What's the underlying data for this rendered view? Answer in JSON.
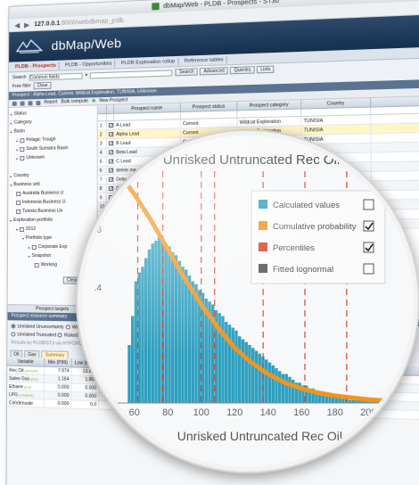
{
  "browser": {
    "tab_title": "dbMap/Web - PLDB - Prospects - ST30",
    "url_host": "127.0.0.1",
    "url_rest": ":8000/webdbmap_pldb"
  },
  "app": {
    "title": "dbMap/Web"
  },
  "menu": [
    {
      "label": "PLDB - Prospects",
      "active": true
    },
    {
      "label": "PLDB - Opportunities",
      "active": false
    },
    {
      "label": "PLDB Exploration rollup",
      "active": false
    },
    {
      "label": "Reference tables",
      "active": false
    }
  ],
  "search": {
    "label": "Search",
    "field_select": "Common fields",
    "free_filter_label": "Free filter",
    "buttons": [
      "Search",
      "Advanced",
      "Queries",
      "Lists"
    ],
    "clear_label": "Clear"
  },
  "prospect_bar": "Prospect : Alpha Lead, Current, Wildcat Exploration, TUNISIA, Unknown",
  "toolbar": {
    "report": "Report",
    "bulk_compute": "Bulk compute",
    "new_prospect": "New Prospect"
  },
  "tree": [
    {
      "label": "Status",
      "level": 0,
      "tri": "▸",
      "cb": false
    },
    {
      "label": "Category",
      "level": 0,
      "tri": "▸",
      "cb": false
    },
    {
      "label": "Basin",
      "level": 0,
      "tri": "▾",
      "cb": false
    },
    {
      "label": "Pelagic Trough",
      "level": 1,
      "tri": "▸",
      "cb": true
    },
    {
      "label": "South Sumatra Basin",
      "level": 1,
      "tri": "▸",
      "cb": true
    },
    {
      "label": "Unknown",
      "level": 1,
      "tri": "▸",
      "cb": true
    },
    {
      "label": "",
      "level": 0,
      "tri": "",
      "cb": false
    },
    {
      "label": "Country",
      "level": 0,
      "tri": "▸",
      "cb": false
    },
    {
      "label": "Business unit",
      "level": 0,
      "tri": "▾",
      "cb": false
    },
    {
      "label": "Australia Business U",
      "level": 1,
      "tri": "",
      "cb": true
    },
    {
      "label": "Indonesia Business U",
      "level": 1,
      "tri": "",
      "cb": true
    },
    {
      "label": "Tunisia Business Un",
      "level": 1,
      "tri": "",
      "cb": true
    },
    {
      "label": "Exploration portfolio",
      "level": 0,
      "tri": "▾",
      "cb": false
    },
    {
      "label": "2012",
      "level": 1,
      "tri": "▾",
      "cb": true
    },
    {
      "label": "Portfolio type",
      "level": 2,
      "tri": "▾",
      "cb": false
    },
    {
      "label": "Corporate Exp",
      "level": 3,
      "tri": "▸",
      "cb": true
    },
    {
      "label": "Snapshot",
      "level": 3,
      "tri": "▾",
      "cb": false
    },
    {
      "label": "Working",
      "level": 4,
      "tri": "",
      "cb": true
    }
  ],
  "tree_clear": "Clear",
  "prospect_targets": "Prospect targets",
  "grid": {
    "columns": [
      "",
      "",
      "Prospect name",
      "Prospect status",
      "Prospect category",
      "Country"
    ],
    "rows": [
      {
        "n": "1",
        "name": "A Lead",
        "status": "Current",
        "category": "Wildcat Exploration",
        "country": "TUNISIA",
        "state": ""
      },
      {
        "n": "2",
        "name": "Alpha Lead",
        "status": "Current",
        "category": "Wildcat Exploration",
        "country": "TUNISIA",
        "state": "sel"
      },
      {
        "n": "3",
        "name": "B Lead",
        "status": "Current",
        "category": "Wildcat Exploration",
        "country": "TUNISIA",
        "state": ""
      },
      {
        "n": "4",
        "name": "Beta Lead",
        "status": "Current",
        "category": "Wildcat Exploration",
        "country": "TUNISIA",
        "state": "alt"
      },
      {
        "n": "5",
        "name": "C Lead",
        "status": "Current",
        "category": "Wildcat Exploration",
        "country": "TUNISIA",
        "state": ""
      },
      {
        "n": "6",
        "name": "delete me",
        "status": "",
        "category": "",
        "country": "",
        "state": "alt"
      },
      {
        "n": "7",
        "name": "Delta l",
        "status": "",
        "category": "",
        "country": "",
        "state": ""
      },
      {
        "n": "8",
        "name": "De",
        "status": "",
        "category": "",
        "country": "",
        "state": "alt"
      },
      {
        "n": "9",
        "name": "",
        "status": "",
        "category": "",
        "country": "",
        "state": ""
      },
      {
        "n": "10",
        "name": "",
        "status": "",
        "category": "",
        "country": "",
        "state": "alt"
      },
      {
        "n": "11",
        "name": "",
        "status": "",
        "category": "",
        "country": "",
        "state": ""
      },
      {
        "n": "12",
        "name": "",
        "status": "",
        "category": "",
        "country": "",
        "state": "alt"
      }
    ]
  },
  "summary": {
    "title": "Prospect resource summary",
    "opt1": "Unrisked Ununcertainty",
    "opt1b": "Weste",
    "opt2": "Unrisked Truncated",
    "opt2b": "Risked",
    "note": "Results by PLDB/ST3 via HYPOPORT file",
    "tabs": [
      "Oil",
      "Gas",
      "Summary"
    ],
    "active_tab": "Summary",
    "columns": [
      "Variable",
      "Min (P99)",
      "Low (P90)",
      ""
    ],
    "rows": [
      {
        "name": "Rec Oil",
        "tag": "(mmbbl)",
        "min": "7.974",
        "low": "13.676",
        "extra": ""
      },
      {
        "name": "Sales Gas",
        "tag": "(bcf)",
        "min": "1.164",
        "low": "1.854",
        "extra": ""
      },
      {
        "name": "Ethane",
        "tag": "(bcf)",
        "min": "0.000",
        "low": "0.000",
        "extra": ""
      },
      {
        "name": "LPG",
        "tag": "(mmbbls)",
        "min": "0.000",
        "low": "0.000",
        "extra": ""
      },
      {
        "name": "Condensate",
        "tag": "",
        "min": "0.000",
        "low": "0.0",
        "extra": ""
      }
    ]
  },
  "chart_data": {
    "type": "bar",
    "title": "Unrisked Untruncated Rec Oil",
    "xlabel": "Unrisked Untruncated Rec Oil",
    "xlim": [
      50,
      210
    ],
    "ylim": [
      0,
      0.8
    ],
    "x_ticks": [
      60,
      80,
      100,
      120,
      140,
      160,
      180,
      200
    ],
    "y_ticks": [
      0.4,
      0.6
    ],
    "y_tick_labels": [
      ".4",
      ".6"
    ],
    "grid": false,
    "legend_position": "top-right",
    "legend": [
      {
        "label": "Calculated values",
        "color": "#2f9fbf",
        "checked": false
      },
      {
        "label": "Cumulative probability",
        "color": "#f0951e",
        "checked": true
      },
      {
        "label": "Percentiles",
        "color": "#d9432a",
        "checked": true
      },
      {
        "label": "Fitted lognormal",
        "color": "#555555",
        "checked": false
      }
    ],
    "histogram": {
      "bin_start": 56,
      "bin_width": 2,
      "values": [
        0.2,
        0.3,
        0.42,
        0.45,
        0.47,
        0.5,
        0.53,
        0.55,
        0.56,
        0.58,
        0.57,
        0.55,
        0.54,
        0.52,
        0.51,
        0.49,
        0.47,
        0.46,
        0.44,
        0.42,
        0.41,
        0.39,
        0.38,
        0.36,
        0.35,
        0.34,
        0.32,
        0.31,
        0.3,
        0.28,
        0.27,
        0.26,
        0.25,
        0.23,
        0.22,
        0.21,
        0.2,
        0.19,
        0.18,
        0.17,
        0.16,
        0.15,
        0.14,
        0.13,
        0.12,
        0.11,
        0.1,
        0.1,
        0.09,
        0.08,
        0.07,
        0.07,
        0.06,
        0.06,
        0.05,
        0.05,
        0.04,
        0.04,
        0.04,
        0.03,
        0.03,
        0.03,
        0.02,
        0.02,
        0.02,
        0.02,
        0.01,
        0.01,
        0.01,
        0.01,
        0.01,
        0.01,
        0.01,
        0.01,
        0.01,
        0.01,
        0.01,
        0.01
      ]
    },
    "cumulative": {
      "x": [
        50,
        60,
        70,
        80,
        90,
        100,
        110,
        120,
        130,
        140,
        150,
        160,
        170,
        180,
        190,
        200,
        210
      ],
      "y": [
        0.8,
        0.72,
        0.63,
        0.53,
        0.43,
        0.34,
        0.26,
        0.19,
        0.14,
        0.1,
        0.07,
        0.05,
        0.035,
        0.025,
        0.018,
        0.012,
        0.008
      ]
    },
    "percentiles": [
      62,
      77,
      100,
      108,
      137,
      162,
      187
    ]
  }
}
